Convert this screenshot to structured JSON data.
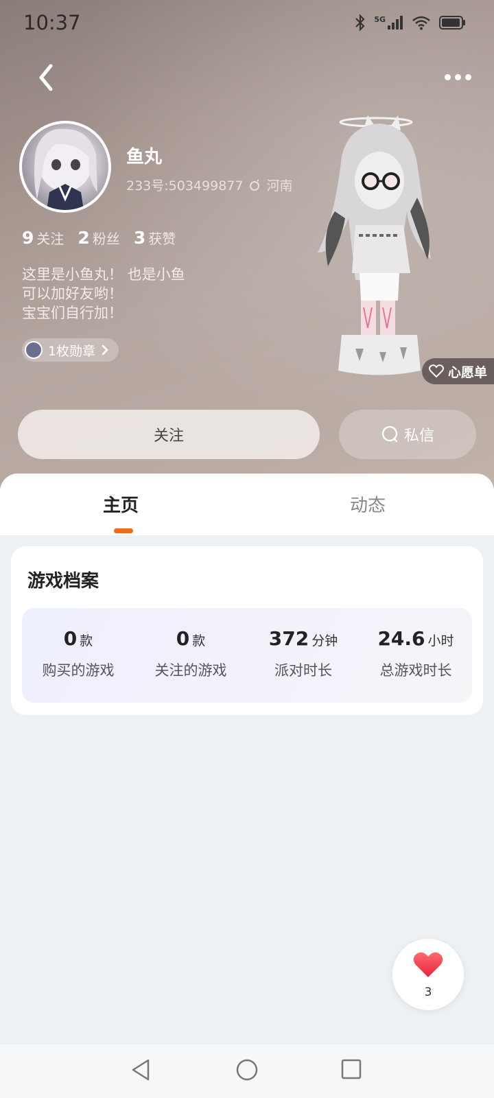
{
  "status_bar": {
    "time": "10:37",
    "network": "5G"
  },
  "header": {
    "back_icon": "chevron-left-icon",
    "more_icon": "more-dots-icon"
  },
  "profile": {
    "name": "鱼丸",
    "id_text": "233号:503499877",
    "location": "河南",
    "stats": [
      {
        "value": "9",
        "label": "关注"
      },
      {
        "value": "2",
        "label": "粉丝"
      },
      {
        "value": "3",
        "label": "获赞"
      }
    ],
    "bio_lines": [
      "这里是小鱼丸！ 也是小鱼",
      "可以加好友哟！",
      "宝宝们自行加！"
    ],
    "badge_label": "1枚勋章"
  },
  "wishlist_label": "心愿单",
  "actions": {
    "follow_label": "关注",
    "message_label": "私信"
  },
  "tabs": [
    {
      "label": "主页",
      "active": true
    },
    {
      "label": "动态",
      "active": false
    }
  ],
  "game_profile": {
    "title": "游戏档案",
    "metrics": [
      {
        "value": "0",
        "unit": "款",
        "label": "购买的游戏"
      },
      {
        "value": "0",
        "unit": "款",
        "label": "关注的游戏"
      },
      {
        "value": "372",
        "unit": "分钟",
        "label": "派对时长"
      },
      {
        "value": "24.6",
        "unit": "小时",
        "label": "总游戏时长"
      }
    ]
  },
  "floating_like": {
    "count": "3"
  },
  "colors": {
    "accent": "#f26a1e",
    "heart": "#f0384e"
  }
}
